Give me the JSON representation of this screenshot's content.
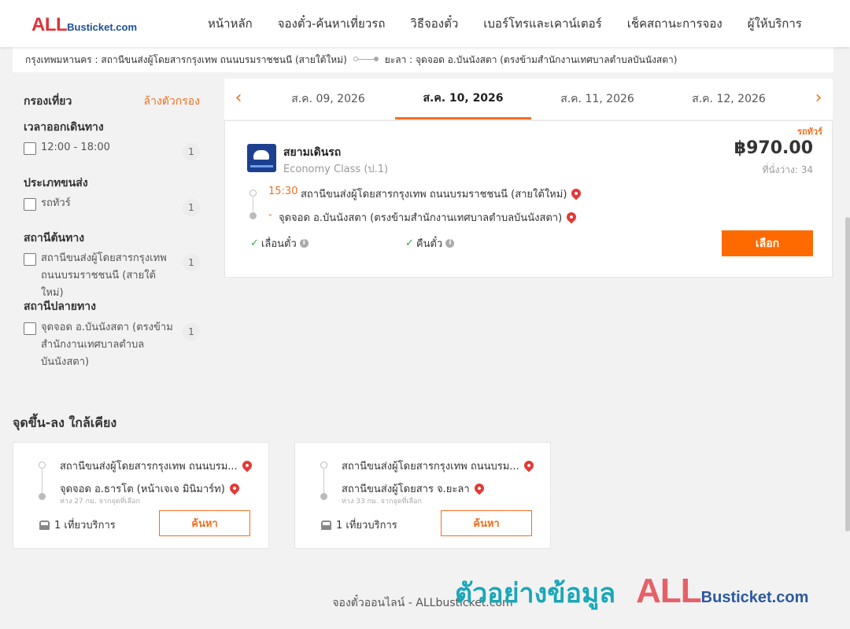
{
  "header": {
    "logo_all": "ALL",
    "logo_rest": "Busticket.com",
    "nav": [
      "หน้าหลัก",
      "จองตั๋ว-ค้นหาเที่ยวรถ",
      "วิธีจองตั๋ว",
      "เบอร์โทรและเคาน์เตอร์",
      "เช็คสถานะการจอง",
      "ผู้ให้บริการ"
    ]
  },
  "route": {
    "origin": "กรุงเทพมหานคร : สถานีขนส่งผู้โดยสารกรุงเทพ ถนนบรมราชชนนี (สายใต้ใหม่)",
    "destination": "ยะลา : จุดจอด อ.บันนังสตา (ตรงข้ามสำนักงานเทศบาลตำบลบันนังสตา)"
  },
  "filters": {
    "title": "กรองเที่ยว",
    "clear": "ล้างตัวกรอง",
    "groups": [
      {
        "title": "เวลาออกเดินทาง",
        "options": [
          {
            "label": "12:00 - 18:00",
            "count": "1"
          }
        ]
      },
      {
        "title": "ประเภทขนส่ง",
        "options": [
          {
            "label": "รถทัวร์",
            "count": "1"
          }
        ]
      },
      {
        "title": "สถานีต้นทาง",
        "options": [
          {
            "label": "สถานีขนส่งผู้โดยสารกรุงเทพ ถนนบรมราชชนนี (สายใต้ใหม่)",
            "count": "1"
          }
        ]
      },
      {
        "title": "สถานีปลายทาง",
        "options": [
          {
            "label": "จุดจอด อ.บันนังสตา (ตรงข้ามสำนักงานเทศบาลตำบลบันนังสตา)",
            "count": "1"
          }
        ]
      }
    ]
  },
  "dates": {
    "tabs": [
      "ส.ค. 09, 2026",
      "ส.ค. 10, 2026",
      "ส.ค. 11, 2026",
      "ส.ค. 12, 2026"
    ],
    "prev": "‹",
    "next": "›"
  },
  "result": {
    "bus_type": "รถทัวร์",
    "operator": "สยามเดินรถ",
    "class": "Economy Class (ป.1)",
    "price": "฿970.00",
    "seats": "ที่นั่งว่าง: 34",
    "dep_time": "15:30",
    "dep_station": "สถานีขนส่งผู้โดยสารกรุงเทพ ถนนบรมราชชนนี (สายใต้ใหม่)",
    "arr_time": "-",
    "arr_station": "จุดจอด อ.บันนังสตา (ตรงข้ามสำนักงานเทศบาลตำบลบันนังสตา)",
    "feature1": "เลื่อนตั๋ว",
    "feature2": "คืนตั๋ว",
    "select": "เลือก"
  },
  "nearby": {
    "title": "จุดขึ้น-ลง ใกล้เคียง",
    "cards": [
      {
        "from": "สถานีขนส่งผู้โดยสารกรุงเทพ ถนนบรม...",
        "to": "จุดจอด อ.ธารโต (หน้าเจเจ มินิมาร์ท)",
        "dist": "ห่าง 27 กม. จากจุดที่เลือก",
        "service": "1 เที่ยวบริการ",
        "button": "ค้นหา"
      },
      {
        "from": "สถานีขนส่งผู้โดยสารกรุงเทพ ถนนบรม...",
        "to": "สถานีขนส่งผู้โดยสาร จ.ยะลา",
        "dist": "ห่าง 33 กม. จากจุดที่เลือก",
        "service": "1 เที่ยวบริการ",
        "button": "ค้นหา"
      }
    ]
  },
  "footer": "จองตั๋วออนไลน์ - ALLbusticket.com",
  "watermark": {
    "text": "ตัวอย่างข้อมูล",
    "all": "ALL",
    "rest": "Busticket.com"
  },
  "colors": {
    "accent": "#f07020",
    "button": "#ff6a00",
    "pin": "#e53935",
    "check": "#2fa84f"
  }
}
